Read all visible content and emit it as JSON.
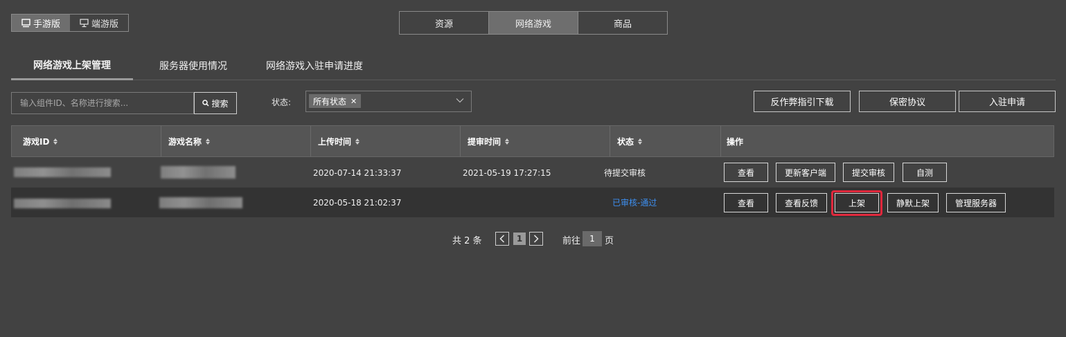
{
  "platform": {
    "mobile_label": "手游版",
    "pc_label": "端游版",
    "active": "mobile"
  },
  "categories": [
    "资源",
    "网络游戏",
    "商品"
  ],
  "active_category": 1,
  "subtabs": [
    "网络游戏上架管理",
    "服务器使用情况",
    "网络游戏入驻申请进度"
  ],
  "active_subtab": 0,
  "search": {
    "placeholder": "输入组件ID、名称进行搜索...",
    "button_label": "搜索"
  },
  "status_filter": {
    "label": "状态:",
    "selected": "所有状态"
  },
  "actions": {
    "anticheat": "反作弊指引下载",
    "privacy": "保密协议",
    "apply": "入驻申请"
  },
  "table": {
    "headers": [
      "游戏ID",
      "游戏名称",
      "上传时间",
      "提审时间",
      "状态",
      "操作"
    ],
    "rows": [
      {
        "upload_time": "2020-07-14 21:33:37",
        "review_time": "2021-05-19 17:27:15",
        "status": "待提交审核",
        "status_color": "#f0f0f0",
        "buttons": [
          "查看",
          "更新客户端",
          "提交审核",
          "自测"
        ]
      },
      {
        "upload_time": "2020-05-18 21:02:37",
        "review_time": "",
        "status": "已审核-通过",
        "status_color": "#3d8ff0",
        "buttons": [
          "查看",
          "查看反馈",
          "上架",
          "静默上架",
          "管理服务器"
        ]
      }
    ]
  },
  "pagination": {
    "total_text": "共 2 条",
    "current_page": "1",
    "goto_prefix": "前往",
    "goto_value": "1",
    "goto_suffix": "页"
  },
  "colors": {
    "background": "#424242",
    "highlight": "#e0283c",
    "approved": "#3d8ff0"
  }
}
